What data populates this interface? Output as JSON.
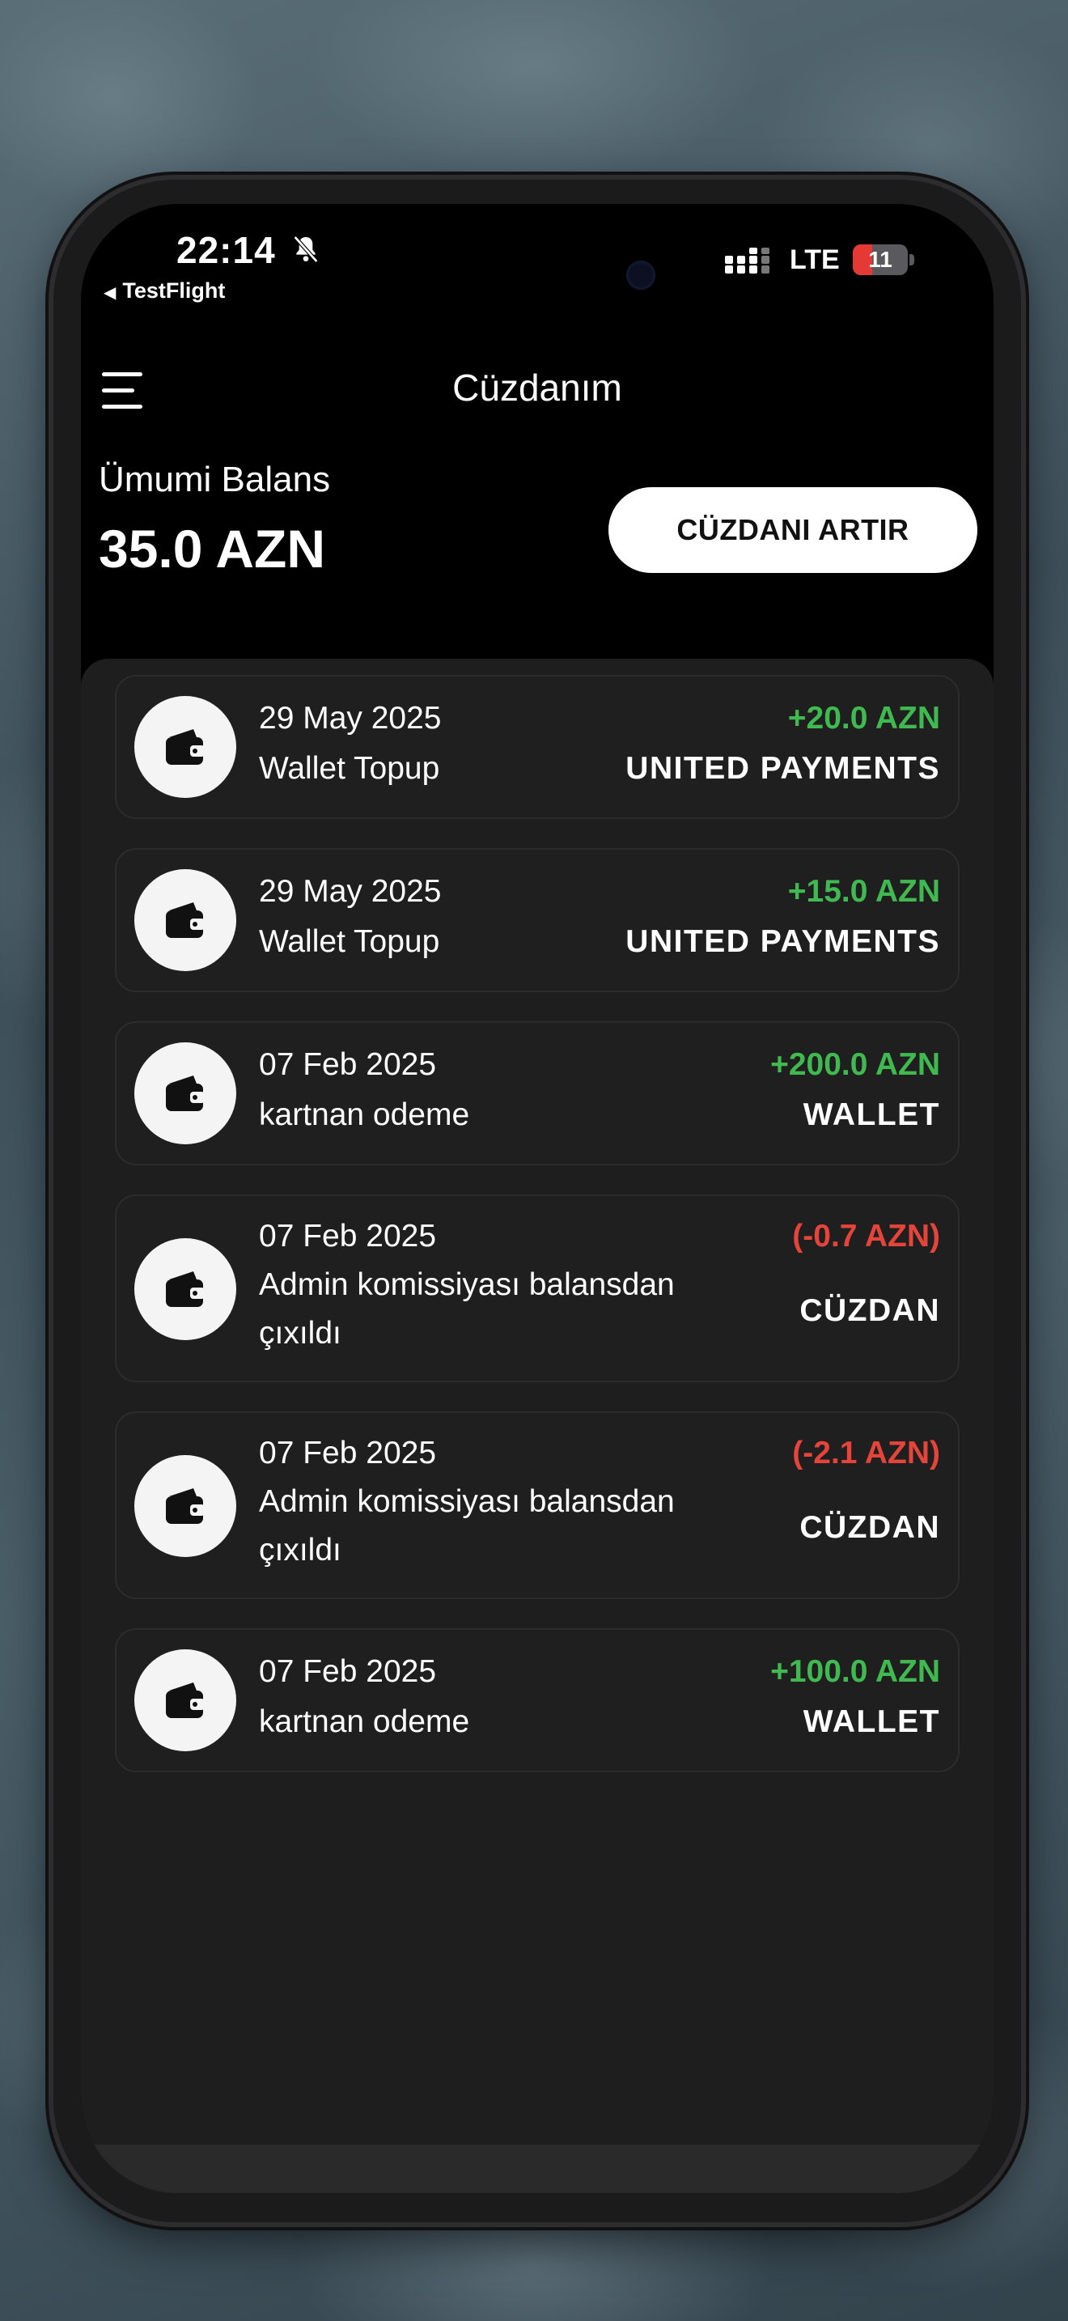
{
  "status_bar": {
    "time": "22:14",
    "back_app": "TestFlight",
    "network": "LTE",
    "battery": "11",
    "battery_level": 0.11
  },
  "header": {
    "title": "Cüzdanım"
  },
  "balance": {
    "label": "Ümumi Balans",
    "value": "35.0 AZN",
    "topup_label": "CÜZDANI ARTIR"
  },
  "transactions": [
    {
      "date": "29 May 2025",
      "description": "Wallet Topup",
      "amount": "+20.0 AZN",
      "method": "UNITED PAYMENTS"
    },
    {
      "date": "29 May 2025",
      "description": "Wallet Topup",
      "amount": "+15.0 AZN",
      "method": "UNITED PAYMENTS"
    },
    {
      "date": "07 Feb 2025",
      "description": "kartnan odeme",
      "amount": "+200.0 AZN",
      "method": "WALLET"
    },
    {
      "date": "07 Feb 2025",
      "description": "Admin komissiyası balansdan çıxıldı",
      "amount": "(-0.7 AZN)",
      "method": "CÜZDAN"
    },
    {
      "date": "07 Feb 2025",
      "description": "Admin komissiyası balansdan çıxıldı",
      "amount": "(-2.1 AZN)",
      "method": "CÜZDAN"
    },
    {
      "date": "07 Feb 2025",
      "description": "kartnan odeme",
      "amount": "+100.0 AZN",
      "method": "WALLET"
    }
  ],
  "colors": {
    "positive": "#3fb950",
    "negative": "#e5443b",
    "card_bg": "#1f1f1f",
    "panel_bg": "#1e1e1e"
  },
  "icons": {
    "transaction": "wallet-icon",
    "menu": "hamburger-menu-icon",
    "notification": "bell-slash-icon"
  }
}
